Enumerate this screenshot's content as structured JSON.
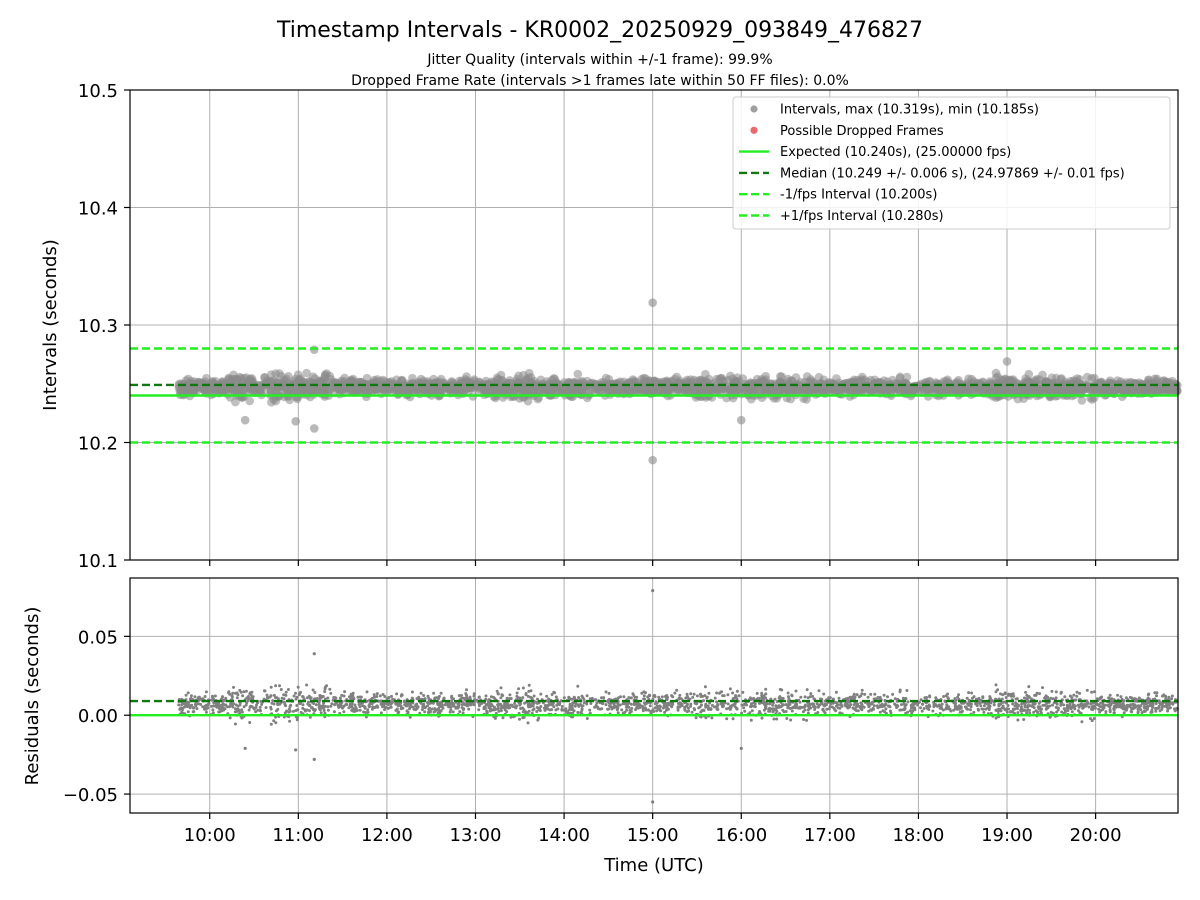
{
  "chart_data": {
    "type": "scatter",
    "title": "Timestamp Intervals - KR0002_20250929_093849_476827",
    "subtitle_lines": [
      "Jitter Quality (intervals within +/-1 frame): 99.9%",
      "Dropped Frame Rate (intervals >1 frames late within 50 FF files): 0.0%"
    ],
    "xlabel": "Time (UTC)",
    "x_ticks": [
      "10:00",
      "11:00",
      "12:00",
      "13:00",
      "14:00",
      "15:00",
      "16:00",
      "17:00",
      "18:00",
      "19:00",
      "20:00"
    ],
    "x_tick_hours": [
      10,
      11,
      12,
      13,
      14,
      15,
      16,
      17,
      18,
      19,
      20
    ],
    "xlim_hours": [
      9.1,
      20.93
    ],
    "data_range_hours": [
      9.65,
      20.93
    ],
    "grid": true,
    "legend_position": "top-right",
    "top_panel": {
      "ylabel": "Intervals (seconds)",
      "ylim": [
        10.1,
        10.5
      ],
      "y_ticks": [
        "10.1",
        "10.2",
        "10.3",
        "10.4",
        "10.5"
      ],
      "y_tick_values": [
        10.1,
        10.2,
        10.3,
        10.4,
        10.5
      ],
      "expected": 10.24,
      "median": 10.249,
      "lower_bound": 10.2,
      "upper_bound": 10.28,
      "max": 10.319,
      "min": 10.185,
      "typical_spread": 0.006,
      "outliers": [
        {
          "t": 15.0,
          "y": 10.319
        },
        {
          "t": 15.0,
          "y": 10.185
        },
        {
          "t": 11.18,
          "y": 10.279
        },
        {
          "t": 11.18,
          "y": 10.212
        },
        {
          "t": 10.4,
          "y": 10.219
        },
        {
          "t": 10.97,
          "y": 10.218
        },
        {
          "t": 16.0,
          "y": 10.219
        },
        {
          "t": 19.0,
          "y": 10.269
        }
      ]
    },
    "bottom_panel": {
      "ylabel": "Residuals (seconds)",
      "ylim": [
        -0.062,
        0.087
      ],
      "y_ticks": [
        "−0.05",
        "0.00",
        "0.05"
      ],
      "y_tick_values": [
        -0.05,
        0.0,
        0.05
      ],
      "expected_residual": 0.0,
      "median_residual": 0.009,
      "outliers": [
        {
          "t": 15.0,
          "y": 0.079
        },
        {
          "t": 15.0,
          "y": -0.055
        },
        {
          "t": 11.18,
          "y": 0.039
        },
        {
          "t": 11.18,
          "y": -0.028
        },
        {
          "t": 10.4,
          "y": -0.021
        },
        {
          "t": 10.97,
          "y": -0.022
        },
        {
          "t": 16.0,
          "y": -0.021
        }
      ]
    },
    "legend": [
      {
        "label": "Intervals, max (10.319s), min (10.185s)",
        "kind": "dot",
        "color": "#a0a0a0"
      },
      {
        "label": "Possible Dropped Frames",
        "kind": "dot",
        "color": "#e86a6a"
      },
      {
        "label": "Expected (10.240s), (25.00000 fps)",
        "kind": "solid",
        "color": "#22ee22"
      },
      {
        "label": "Median (10.249 +/- 0.006 s), (24.97869 +/- 0.01 fps)",
        "kind": "dashed",
        "color": "#117711"
      },
      {
        "label": "-1/fps Interval (10.200s)",
        "kind": "dashed",
        "color": "#22ee22"
      },
      {
        "label": "+1/fps Interval (10.280s)",
        "kind": "dashed",
        "color": "#22ee22"
      }
    ],
    "colors": {
      "points": "#808080",
      "expected": "#22ee22",
      "median": "#117711",
      "bounds": "#22ee22",
      "grid": "#b0b0b0"
    }
  }
}
